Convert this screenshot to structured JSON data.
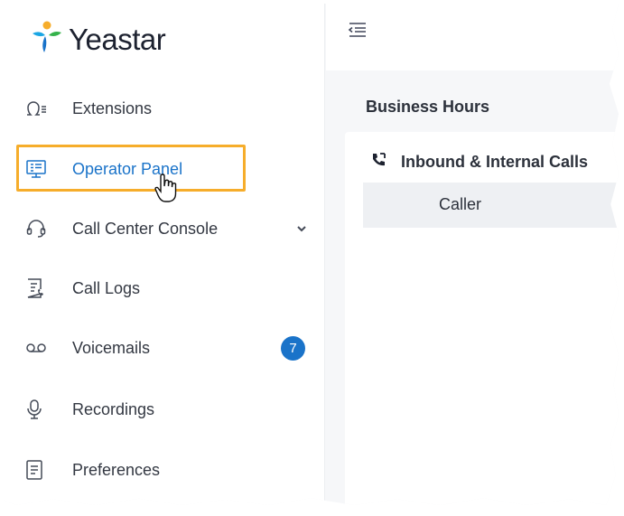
{
  "brand": {
    "name": "Yeastar"
  },
  "sidebar": {
    "items": [
      {
        "label": "Extensions",
        "icon": "extension-icon"
      },
      {
        "label": "Operator Panel",
        "icon": "operator-panel-icon",
        "active": true
      },
      {
        "label": "Call Center Console",
        "icon": "headset-icon",
        "expandable": true
      },
      {
        "label": "Call Logs",
        "icon": "call-logs-icon"
      },
      {
        "label": "Voicemails",
        "icon": "voicemail-icon",
        "badge": "7"
      },
      {
        "label": "Recordings",
        "icon": "microphone-icon"
      },
      {
        "label": "Preferences",
        "icon": "preferences-icon"
      }
    ]
  },
  "content": {
    "section_title": "Business Hours",
    "card": {
      "header": "Inbound & Internal Calls",
      "columns": [
        "Caller"
      ]
    }
  },
  "colors": {
    "accent": "#1a73c9",
    "highlight": "#f6ad2b"
  }
}
